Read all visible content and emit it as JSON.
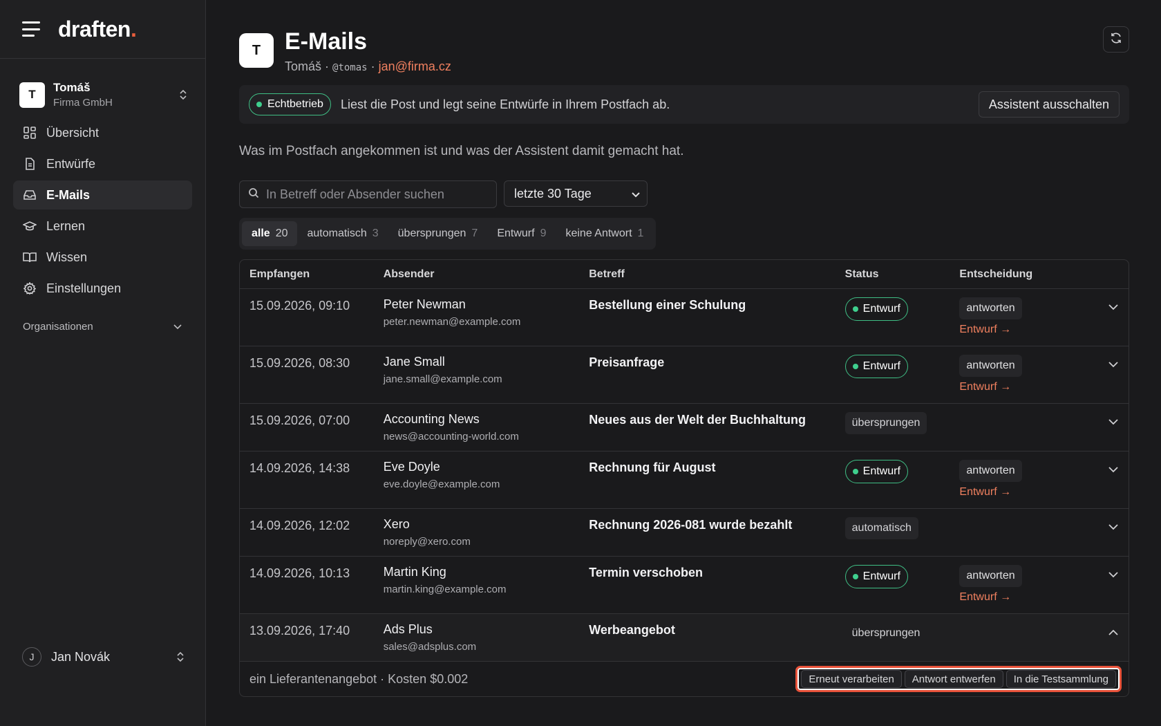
{
  "app": {
    "logo_text": "draften",
    "logo_dot": "."
  },
  "org": {
    "avatar": "T",
    "name": "Tomáš",
    "company": "Firma GmbH"
  },
  "nav": [
    {
      "label": "Übersicht",
      "icon": "dashboard-icon"
    },
    {
      "label": "Entwürfe",
      "icon": "document-icon"
    },
    {
      "label": "E-Mails",
      "icon": "inbox-icon",
      "active": true
    },
    {
      "label": "Lernen",
      "icon": "graduation-cap-icon"
    },
    {
      "label": "Wissen",
      "icon": "book-icon"
    },
    {
      "label": "Einstellungen",
      "icon": "gear-icon"
    }
  ],
  "organisations_label": "Organisationen",
  "user": {
    "initial": "J",
    "name": "Jan Novák"
  },
  "page": {
    "avatar": "T",
    "title": "E-Mails",
    "owner": "Tomáš",
    "sep1": " · ",
    "handle": "@tomas",
    "sep2": " · ",
    "email": "jan@firma.cz"
  },
  "banner": {
    "badge": "Echtbetrieb",
    "text": "Liest die Post und legt seine Entwürfe in Ihrem Postfach ab.",
    "button": "Assistent ausschalten"
  },
  "description": "Was im Postfach angekommen ist und was der Assistent damit gemacht hat.",
  "search": {
    "placeholder": "In Betreff oder Absender suchen"
  },
  "period": {
    "selected": "letzte 30 Tage"
  },
  "tabs": [
    {
      "label": "alle",
      "count": "20",
      "active": true
    },
    {
      "label": "automatisch",
      "count": "3"
    },
    {
      "label": "übersprungen",
      "count": "7"
    },
    {
      "label": "Entwurf",
      "count": "9"
    },
    {
      "label": "keine Antwort",
      "count": "1"
    }
  ],
  "table": {
    "headers": [
      "Empfangen",
      "Absender",
      "Betreff",
      "Status",
      "Entscheidung"
    ],
    "rows": [
      {
        "date": "15.09.2026, 09:10",
        "name": "Peter Newman",
        "email": "peter.newman@example.com",
        "subject": "Bestellung einer Schulung",
        "status": "Entwurf",
        "decision": "antworten",
        "link": "Entwurf →"
      },
      {
        "date": "15.09.2026, 08:30",
        "name": "Jane Small",
        "email": "jane.small@example.com",
        "subject": "Preisanfrage",
        "status": "Entwurf",
        "decision": "antworten",
        "link": "Entwurf →"
      },
      {
        "date": "15.09.2026, 07:00",
        "name": "Accounting News",
        "email": "news@accounting-world.com",
        "subject": "Neues aus der Welt der Buchhaltung",
        "status": "übersprungen",
        "decision": "",
        "link": ""
      },
      {
        "date": "14.09.2026, 14:38",
        "name": "Eve Doyle",
        "email": "eve.doyle@example.com",
        "subject": "Rechnung für August",
        "status": "Entwurf",
        "decision": "antworten",
        "link": "Entwurf →"
      },
      {
        "date": "14.09.2026, 12:02",
        "name": "Xero",
        "email": "noreply@xero.com",
        "subject": "Rechnung 2026-081 wurde bezahlt",
        "status": "automatisch",
        "decision": "",
        "link": ""
      },
      {
        "date": "14.09.2026, 10:13",
        "name": "Martin King",
        "email": "martin.king@example.com",
        "subject": "Termin verschoben",
        "status": "Entwurf",
        "decision": "antworten",
        "link": "Entwurf →"
      },
      {
        "date": "13.09.2026, 17:40",
        "name": "Ads Plus",
        "email": "sales@adsplus.com",
        "subject": "Werbeangebot",
        "status": "übersprungen",
        "decision": "",
        "link": "",
        "expanded": true
      }
    ],
    "detail": {
      "text": "ein Lieferantenangebot · Kosten $0.002",
      "actions": [
        "Erneut verarbeiten",
        "Antwort entwerfen",
        "In die Testsammlung"
      ]
    }
  },
  "colors": {
    "accent": "#f0805f",
    "success": "#3fcf8e",
    "highlight": "#e8523a"
  }
}
